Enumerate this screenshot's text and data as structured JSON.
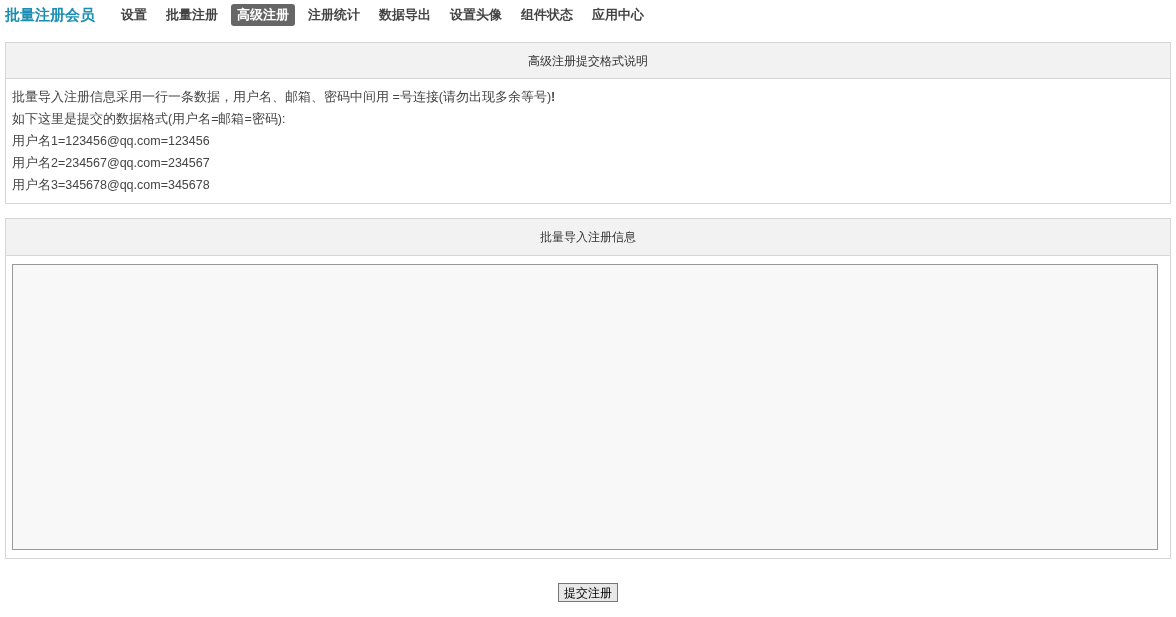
{
  "nav": {
    "brand": "批量注册会员",
    "items": [
      {
        "label": "设置",
        "selected": false
      },
      {
        "label": "批量注册",
        "selected": false
      },
      {
        "label": "高级注册",
        "selected": true
      },
      {
        "label": "注册统计",
        "selected": false
      },
      {
        "label": "数据导出",
        "selected": false
      },
      {
        "label": "设置头像",
        "selected": false
      },
      {
        "label": "组件状态",
        "selected": false
      },
      {
        "label": "应用中心",
        "selected": false
      }
    ]
  },
  "format_panel": {
    "title": "高级注册提交格式说明",
    "lines": [
      "批量导入注册信息采用一行一条数据，用户名、邮箱、密码中间用 =号连接(请勿出现多余等号)**!**",
      "如下这里是提交的数据格式(用户名=邮箱=密码):",
      "用户名1=123456@qq.com=123456",
      "用户名2=234567@qq.com=234567",
      "用户名3=345678@qq.com=345678"
    ]
  },
  "import_panel": {
    "title": "批量导入注册信息"
  },
  "submit_button": "提交注册"
}
